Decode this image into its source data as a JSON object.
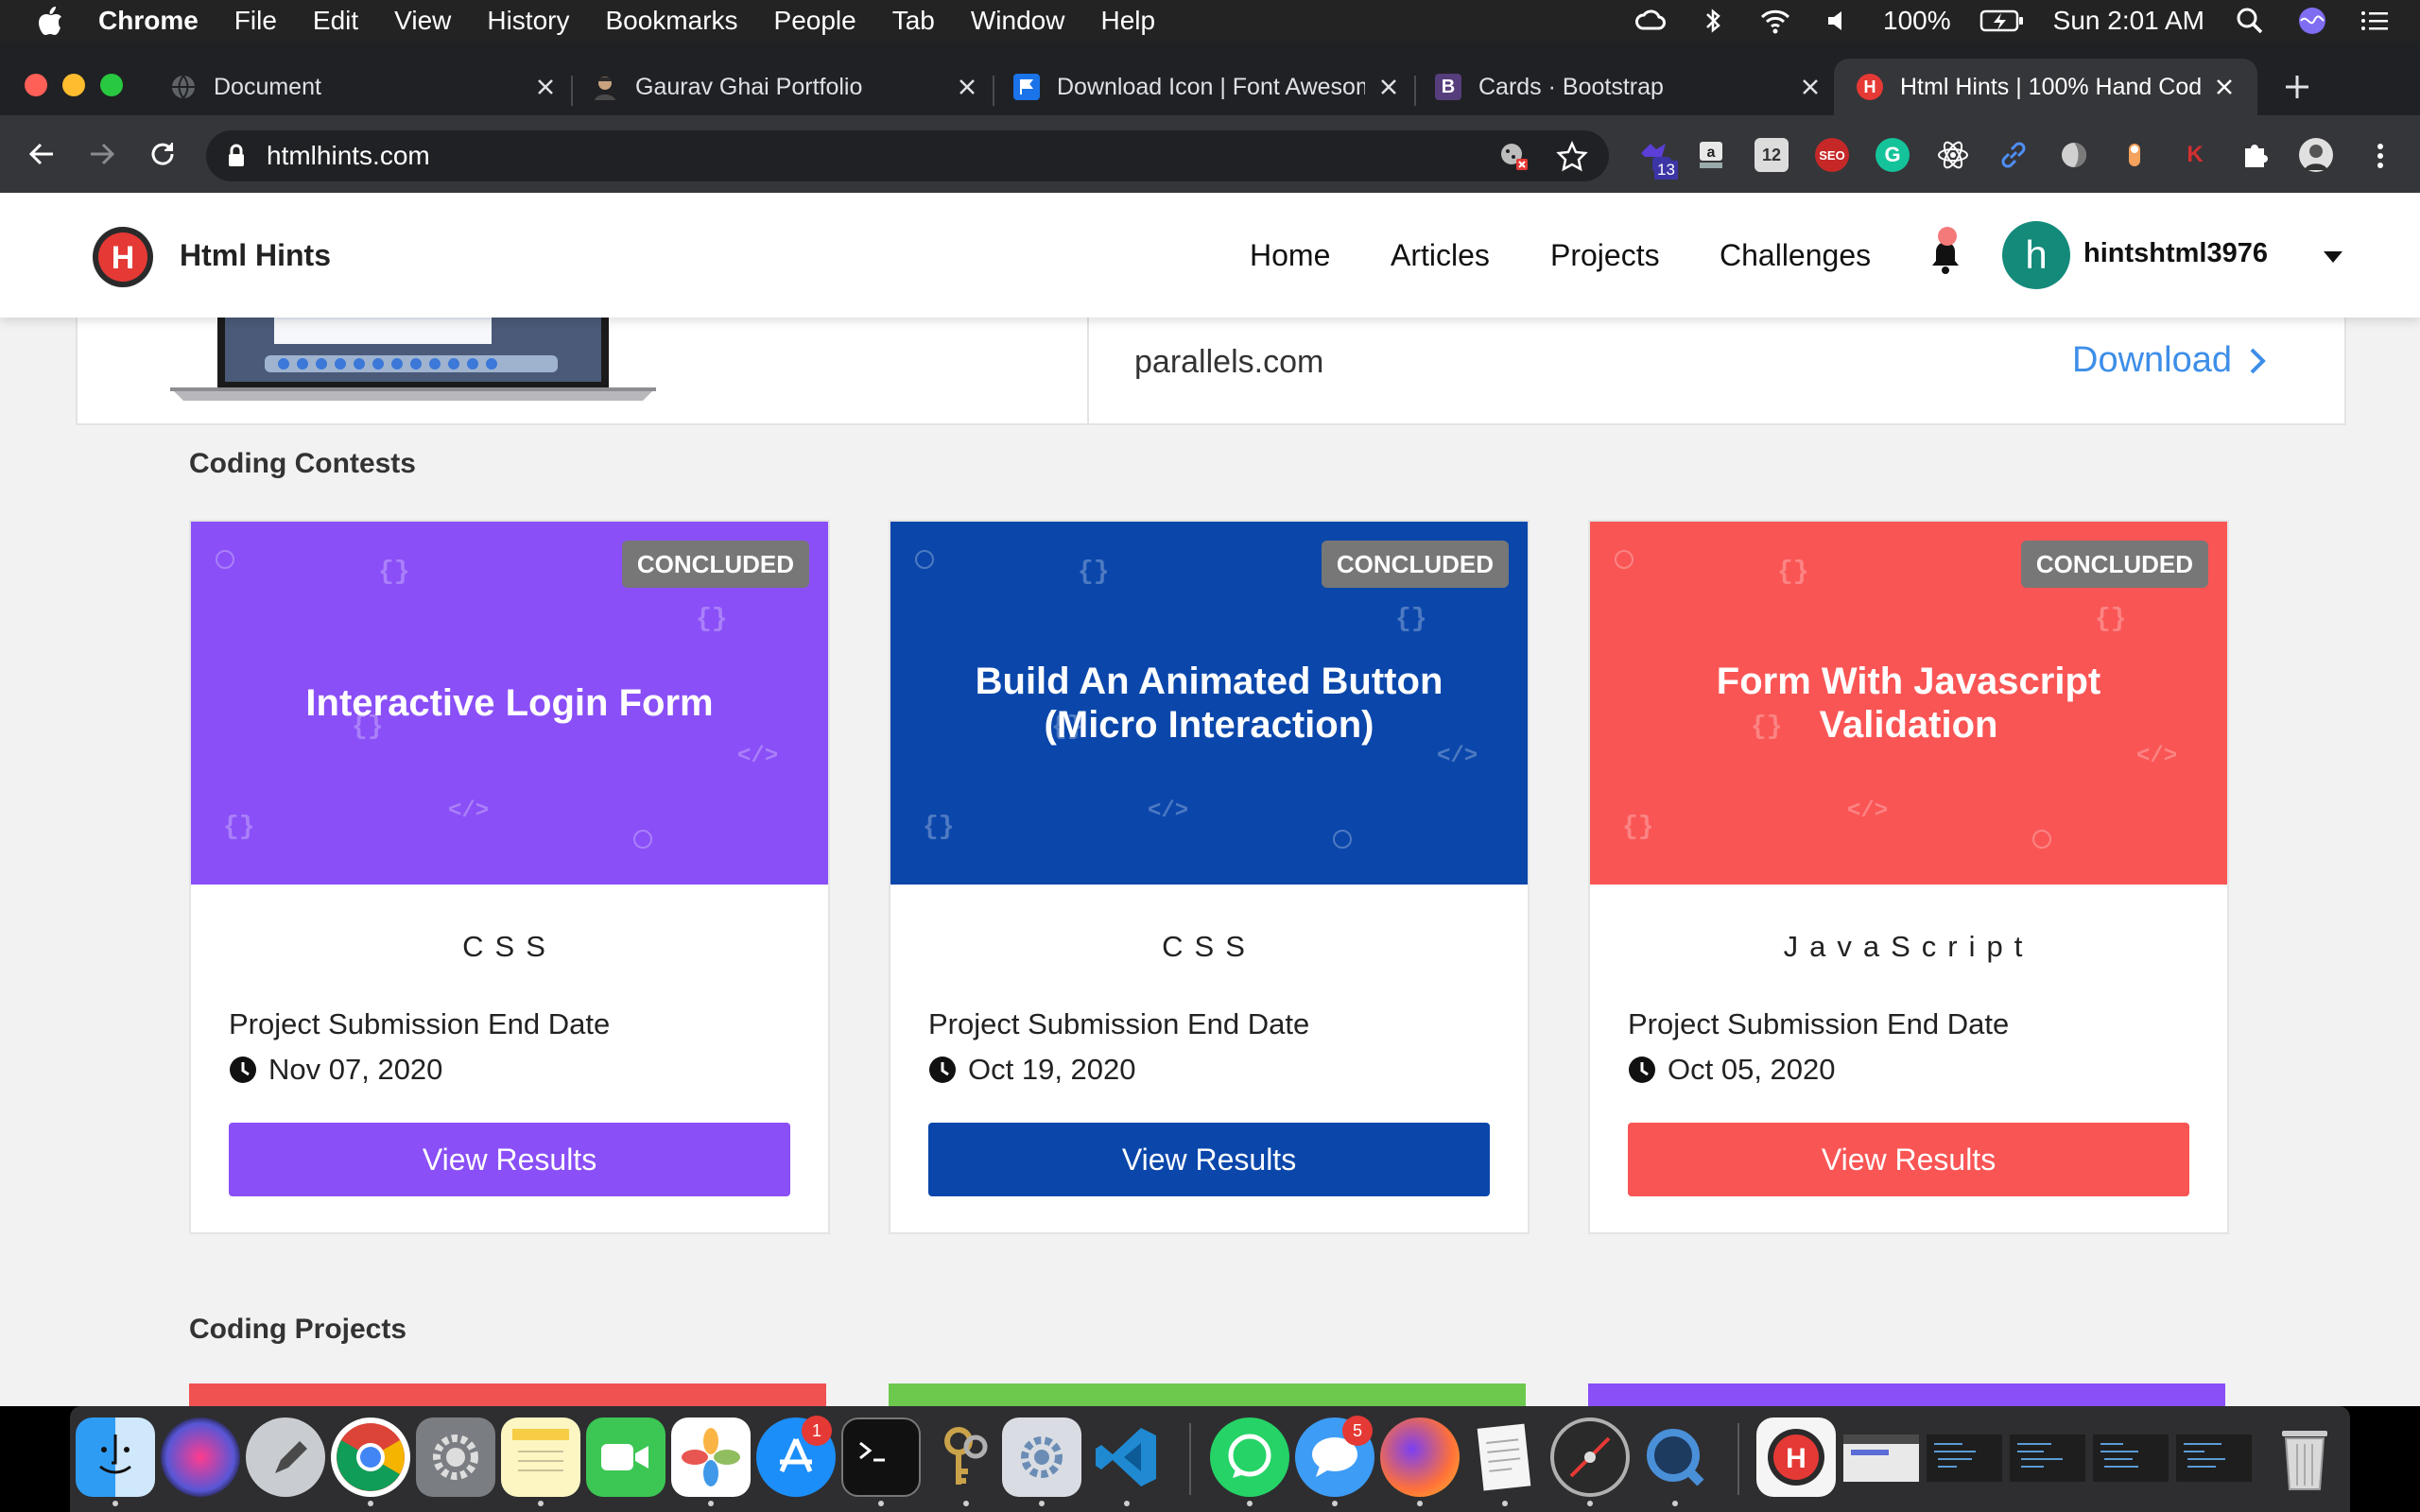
{
  "menubar": {
    "app": "Chrome",
    "items": [
      "File",
      "Edit",
      "View",
      "History",
      "Bookmarks",
      "People",
      "Tab",
      "Window",
      "Help"
    ],
    "battery": "100%",
    "clock": "Sun 2:01 AM"
  },
  "tabs": [
    {
      "title": "Document",
      "icon": "globe-icon"
    },
    {
      "title": "Gaurav Ghai Portfolio",
      "icon": "portrait-icon"
    },
    {
      "title": "Download Icon | Font Awesome",
      "icon": "flag-icon"
    },
    {
      "title": "Cards · Bootstrap",
      "icon": "bootstrap-icon"
    },
    {
      "title": "Html Hints | 100% Hand Coded",
      "icon": "htmlhints-icon",
      "active": true
    }
  ],
  "toolbar": {
    "url": "htmlhints.com",
    "ext_badge": "13",
    "calendar_ext": "12",
    "seo_ext": "SEO"
  },
  "site": {
    "brand": "Html Hints",
    "logo_letter": "H",
    "nav": [
      "Home",
      "Articles",
      "Projects",
      "Challenges"
    ],
    "avatar_letter": "h",
    "username": "hintshtml3976",
    "accent": "#e53935"
  },
  "ad": {
    "domain": "parallels.com",
    "cta": "Download"
  },
  "contests": {
    "title": "Coding Contests",
    "label": "Project Submission End Date",
    "badge": "CONCLUDED",
    "button": "View Results",
    "cards": [
      {
        "title": "Interactive Login Form",
        "category": "CSS",
        "date": "Nov 07, 2020",
        "color": "#8a4ff7"
      },
      {
        "title": "Build An Animated Button (Micro Interaction)",
        "category": "CSS",
        "date": "Oct 19, 2020",
        "color": "#0b47ab"
      },
      {
        "title": "Form With Javascript Validation",
        "category": "JavaScript",
        "date": "Oct 05, 2020",
        "color": "#fa5555"
      }
    ]
  },
  "projects": {
    "title": "Coding Projects",
    "strip_colors": [
      "#f05252",
      "#6cc94e",
      "#8a4ff7"
    ]
  },
  "dock": {
    "appstore_badge": "1",
    "messages_badge": "5"
  }
}
